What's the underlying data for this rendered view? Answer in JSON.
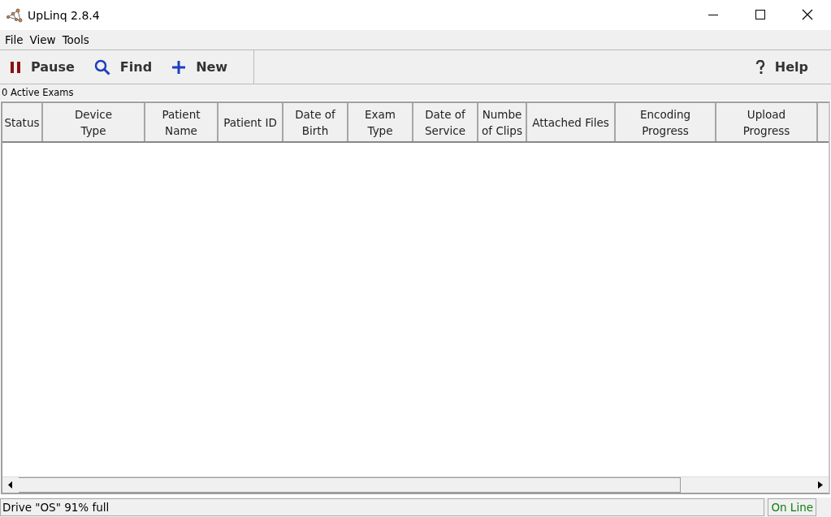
{
  "window": {
    "title": "UpLinq 2.8.4"
  },
  "menu": [
    "File",
    "View",
    "Tools"
  ],
  "toolbar": {
    "buttons": [
      {
        "kind": "pause",
        "label": "Pause"
      },
      {
        "kind": "find",
        "label": "Find"
      },
      {
        "kind": "new",
        "label": "New"
      }
    ],
    "help": {
      "kind": "help",
      "label": "Help"
    }
  },
  "exam_count": "0 Active Exams",
  "table": {
    "columns": [
      {
        "label": "Status"
      },
      {
        "label": "Device\nType"
      },
      {
        "label": "Patient\nName"
      },
      {
        "label": "Patient ID"
      },
      {
        "label": "Date of\nBirth"
      },
      {
        "label": "Exam\nType"
      },
      {
        "label": "Date of\nService"
      },
      {
        "label": "Numbe\nof Clips"
      },
      {
        "label": "Attached Files"
      },
      {
        "label": "Encoding\nProgress"
      },
      {
        "label": "Upload\nProgress"
      }
    ]
  },
  "status_bar": {
    "drive": "Drive \"OS\" 91% full",
    "connection": "On Line"
  }
}
